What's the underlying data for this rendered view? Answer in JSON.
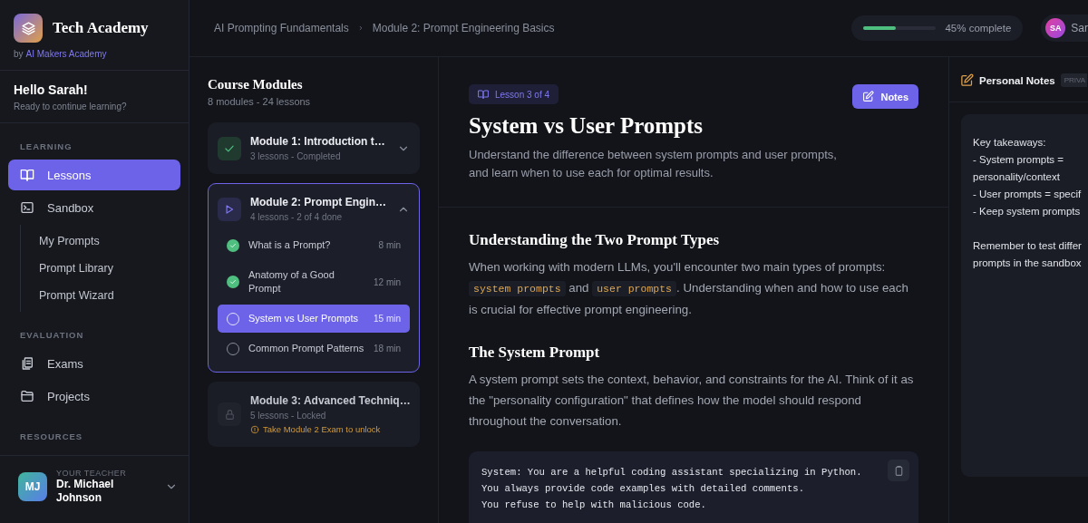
{
  "brand": {
    "name": "Tech Academy",
    "by_prefix": "by",
    "by_link": "AI Makers Academy"
  },
  "greeting": {
    "title": "Hello Sarah!",
    "subtitle": "Ready to continue learning?"
  },
  "nav": [
    {
      "heading": "LEARNING",
      "items": [
        {
          "label": "Lessons",
          "selected": true
        },
        {
          "label": "Sandbox",
          "selected": false,
          "children": [
            {
              "label": "My Prompts"
            },
            {
              "label": "Prompt Library"
            },
            {
              "label": "Prompt Wizard"
            }
          ]
        }
      ]
    },
    {
      "heading": "EVALUATION",
      "items": [
        {
          "label": "Exams",
          "selected": false
        },
        {
          "label": "Projects",
          "selected": false
        }
      ]
    },
    {
      "heading": "RESOURCES"
    }
  ],
  "teacher": {
    "caption": "YOUR TEACHER",
    "initials": "MJ",
    "name": "Dr. Michael Johnson"
  },
  "breadcrumb": [
    "AI Prompting Fundamentals",
    "Module 2: Prompt Engineering Basics"
  ],
  "progress": {
    "level": 0.45,
    "label": "45% complete"
  },
  "user": {
    "initials": "SA",
    "name": "Sar"
  },
  "modules_panel": {
    "title": "Course Modules",
    "subtitle": "8 modules - 24 lessons"
  },
  "modules": [
    {
      "kind": "completed",
      "title": "Module 1: Introduction t…",
      "meta": "3 lessons - Completed",
      "expanded": false
    },
    {
      "kind": "active",
      "title": "Module 2: Prompt Engin…",
      "meta": "4 lessons - 2 of 4 done",
      "expanded": true,
      "lessons": [
        {
          "title": "What is a Prompt?",
          "duration": "8 min",
          "done": true,
          "selected": false
        },
        {
          "title": "Anatomy of a Good Prompt",
          "duration": "12 min",
          "done": true,
          "selected": false
        },
        {
          "title": "System vs User Prompts",
          "duration": "15 min",
          "done": false,
          "selected": true
        },
        {
          "title": "Common Prompt Patterns",
          "duration": "18 min",
          "done": false,
          "selected": false
        }
      ]
    },
    {
      "kind": "locked",
      "title": "Module 3: Advanced Techniq…",
      "meta": "5 lessons - Locked",
      "warning": "Take Module 2 Exam to unlock"
    }
  ],
  "lesson": {
    "badge": "Lesson 3 of 4",
    "notes_button": "Notes",
    "title": "System vs User Prompts",
    "subtitle": "Understand the difference between system prompts and user prompts, and learn when to use each for optimal results.",
    "sections": [
      {
        "heading": "Understanding the Two Prompt Types",
        "parts": [
          {
            "kind": "text",
            "text": "When working with modern LLMs, you'll encounter two main types of prompts: "
          },
          {
            "kind": "code",
            "text": "system prompts"
          },
          {
            "kind": "text",
            "text": " and "
          },
          {
            "kind": "code",
            "text": "user prompts"
          },
          {
            "kind": "text",
            "text": ". Understanding when and how to use each is crucial for effective prompt engineering."
          }
        ]
      },
      {
        "heading": "The System Prompt",
        "parts": [
          {
            "kind": "text",
            "text": "A system prompt sets the context, behavior, and constraints for the AI. Think of it as the \"personality configuration\" that defines how the model should respond throughout the conversation."
          }
        ],
        "code": [
          "System: You are a helpful coding assistant specializing in Python.",
          "You always provide code examples with detailed comments.",
          "You refuse to help with malicious code."
        ]
      }
    ]
  },
  "notes": {
    "title": "Personal Notes",
    "badge": "PRIVA",
    "paragraphs": [
      [
        "Key takeaways:",
        "- System prompts =",
        "personality/context",
        "- User prompts = specif",
        "- Keep system prompts"
      ],
      [
        "Remember to test differ",
        "prompts in the sandbox"
      ]
    ]
  }
}
